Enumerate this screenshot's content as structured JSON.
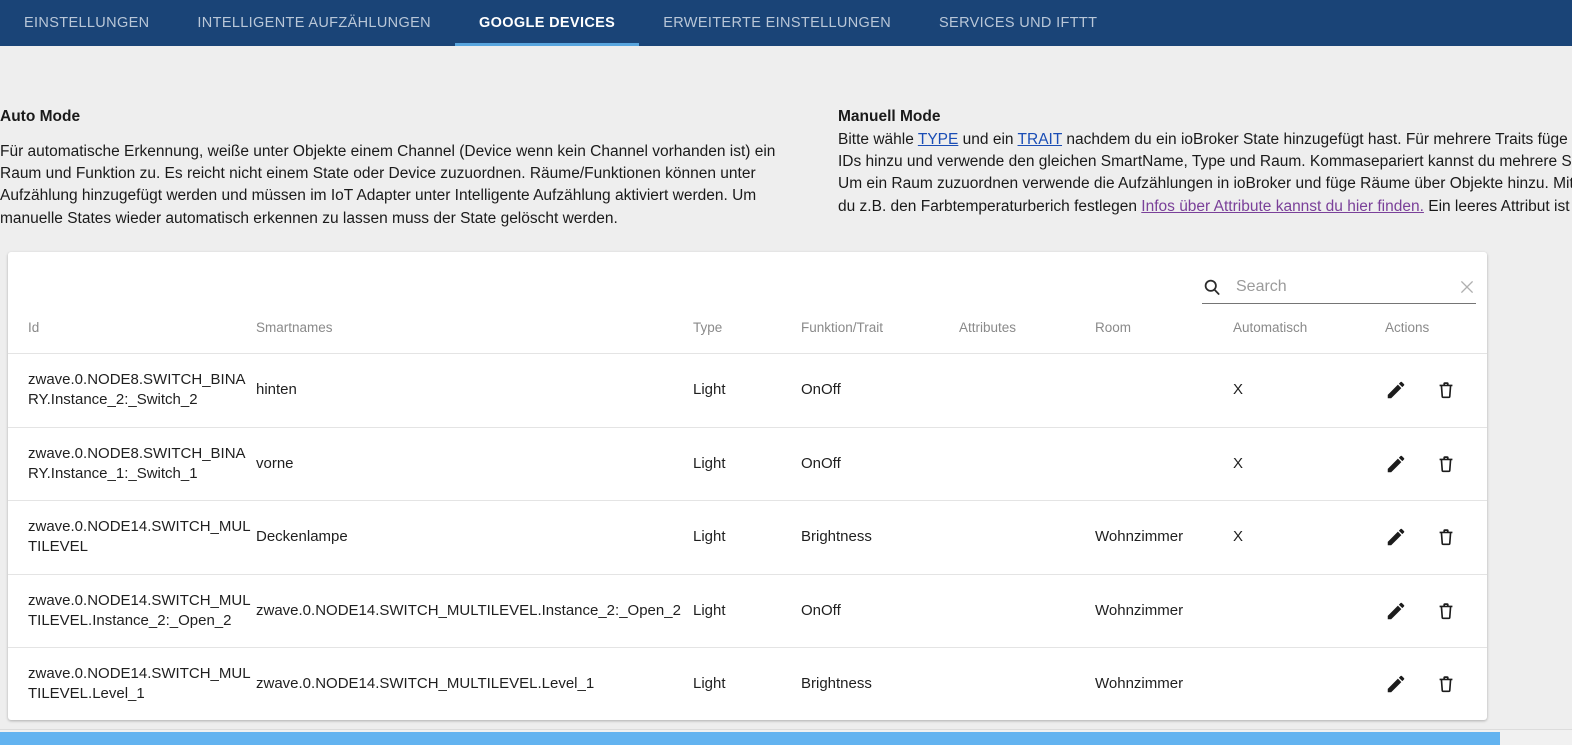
{
  "tabs": [
    {
      "label": "EINSTELLUNGEN",
      "active": false
    },
    {
      "label": "INTELLIGENTE AUFZÄHLUNGEN",
      "active": false
    },
    {
      "label": "GOOGLE DEVICES",
      "active": true
    },
    {
      "label": "ERWEITERTE EINSTELLUNGEN",
      "active": false
    },
    {
      "label": "SERVICES UND IFTTT",
      "active": false
    }
  ],
  "info": {
    "auto": {
      "title": "Auto Mode",
      "body": "Für automatische Erkennung, weiße unter Objekte einem Channel (Device wenn kein Channel vorhanden ist) ein Raum und Funktion zu. Es reicht nicht einem State oder Device zuzuordnen. Räume/Funktionen können unter Aufzählung hinzugefügt werden und müssen im IoT Adapter unter Intelligente Aufzählung aktiviert werden. Um manuelle States wieder automatisch erkennen zu lassen muss der State gelöscht werden."
    },
    "manual": {
      "title": "Manuell Mode",
      "part1": "Bitte wähle ",
      "link_type": "TYPE",
      "part2": " und ein ",
      "link_trait": "TRAIT",
      "part3": " nachdem du ein ioBroker State hinzugefügt hast. Für mehrere Traits füge unterschiedliche State IDs hinzu und verwende den gleichen SmartName, Type und Raum. Kommasepariert kannst du mehrere Smartnamen hinzufügen. Um ein Raum zuzuordnen verwende die Aufzählungen in ioBroker und füge Räume über Objekte hinzu. Mit den Attributes kannst du z.B. den Farbtemperaturberich festlegen ",
      "link_infos": "Infos über Attribute kannst du hier finden.",
      "part4": " Ein leeres Attribut ist {}"
    }
  },
  "search": {
    "placeholder": "Search",
    "value": "",
    "icon": "search-icon",
    "clear_icon": "close-icon"
  },
  "table": {
    "headers": {
      "id": "Id",
      "smartnames": "Smartnames",
      "type": "Type",
      "funktion": "Funktion/Trait",
      "attributes": "Attributes",
      "room": "Room",
      "automatisch": "Automatisch",
      "actions": "Actions"
    },
    "rows": [
      {
        "id": "zwave.0.NODE8.SWITCH_BINARY.Instance_2:_Switch_2",
        "smartnames": "hinten",
        "type": "Light",
        "funktion": "OnOff",
        "attributes": "",
        "room": "",
        "automatisch": "X"
      },
      {
        "id": "zwave.0.NODE8.SWITCH_BINARY.Instance_1:_Switch_1",
        "smartnames": "vorne",
        "type": "Light",
        "funktion": "OnOff",
        "attributes": "",
        "room": "",
        "automatisch": "X"
      },
      {
        "id": "zwave.0.NODE14.SWITCH_MULTILEVEL",
        "smartnames": "Deckenlampe",
        "type": "Light",
        "funktion": "Brightness",
        "attributes": "",
        "room": "Wohnzimmer",
        "automatisch": "X"
      },
      {
        "id": "zwave.0.NODE14.SWITCH_MULTILEVEL.Instance_2:_Open_2",
        "smartnames": "zwave.0.NODE14.SWITCH_MULTILEVEL.Instance_2:_Open_2",
        "type": "Light",
        "funktion": "OnOff",
        "attributes": "",
        "room": "Wohnzimmer",
        "automatisch": ""
      },
      {
        "id": "zwave.0.NODE14.SWITCH_MULTILEVEL.Level_1",
        "smartnames": "zwave.0.NODE14.SWITCH_MULTILEVEL.Level_1",
        "type": "Light",
        "funktion": "Brightness",
        "attributes": "",
        "room": "Wohnzimmer",
        "automatisch": ""
      }
    ],
    "row_actions": {
      "edit_icon": "pencil-icon",
      "delete_icon": "trash-icon"
    }
  },
  "colors": {
    "tabbar": "#1a4477",
    "tab_active_underline": "#58a5de",
    "page_background": "#eeeeee",
    "scrollbar_thumb": "#63b3f0",
    "link": "#1a4db5",
    "link_visited": "#7a4099"
  }
}
